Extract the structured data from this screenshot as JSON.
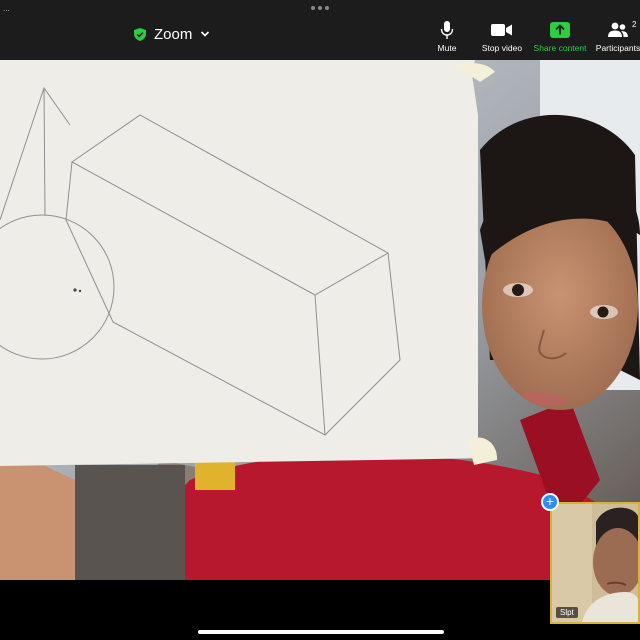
{
  "status_bar": {
    "left_text": "..."
  },
  "header": {
    "title": "Zoom",
    "secure_color": "#2ecc40",
    "icons": {
      "secure": "shield-check-icon",
      "dropdown": "chevron-down-icon",
      "more": "more-dots-icon"
    }
  },
  "controls": [
    {
      "label": "Mute",
      "icon": "microphone-icon"
    },
    {
      "label": "Stop video",
      "icon": "video-camera-icon"
    },
    {
      "label": "Share content",
      "icon": "share-upload-icon",
      "color": "#2ecc40"
    },
    {
      "label": "Participants",
      "icon": "participants-icon",
      "count": "2"
    }
  ],
  "self_view": {
    "label": "Slpt"
  }
}
